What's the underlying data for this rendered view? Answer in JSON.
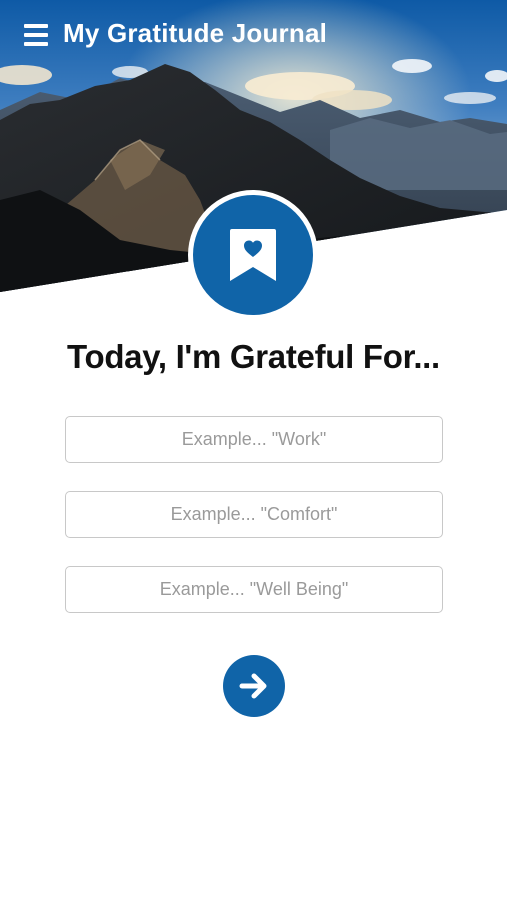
{
  "header": {
    "title": "My Gratitude Journal",
    "menu_icon": "hamburger-menu-icon"
  },
  "hero": {
    "image": "mountain-landscape",
    "badge_icon": "bookmark-heart-icon"
  },
  "main": {
    "headline": "Today, I'm Grateful For...",
    "inputs": [
      {
        "value": "",
        "placeholder": "Example... \"Work\""
      },
      {
        "value": "",
        "placeholder": "Example... \"Comfort\""
      },
      {
        "value": "",
        "placeholder": "Example... \"Well Being\""
      }
    ],
    "next_icon": "arrow-right-icon"
  },
  "colors": {
    "brand_blue": "#1064a8",
    "sky_blue": "#3f7ec0",
    "background": "#ffffff",
    "text": "#111111",
    "placeholder": "#9a9a9a",
    "field_border": "#c8c8c8"
  }
}
